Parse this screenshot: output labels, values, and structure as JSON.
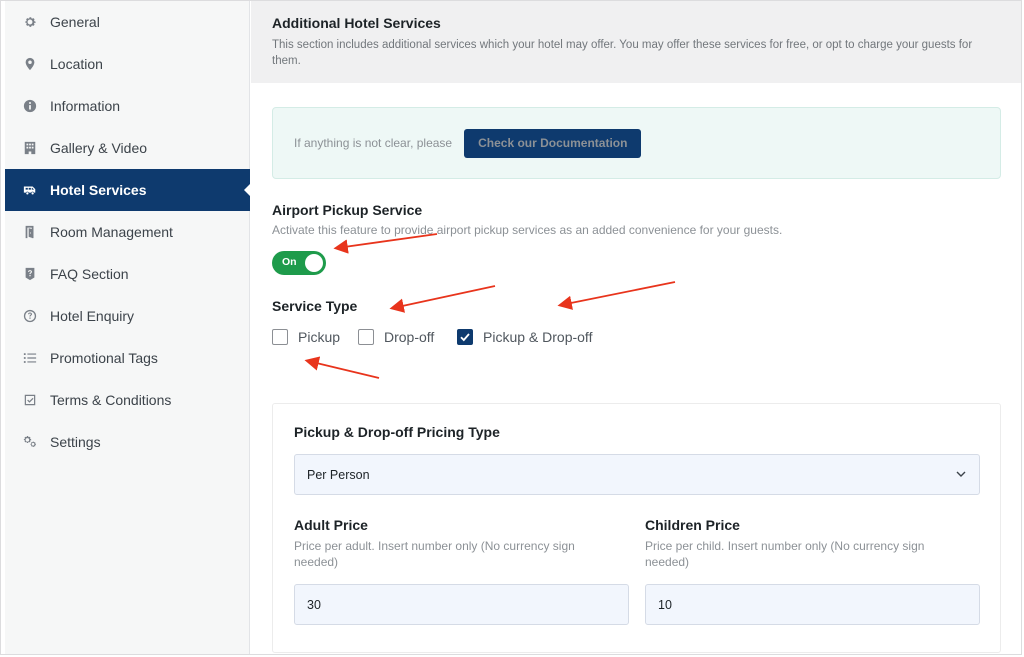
{
  "sidebar": {
    "items": [
      {
        "label": "General",
        "icon": "gear-icon"
      },
      {
        "label": "Location",
        "icon": "map-pin-icon"
      },
      {
        "label": "Information",
        "icon": "info-icon"
      },
      {
        "label": "Gallery & Video",
        "icon": "building-icon"
      },
      {
        "label": "Hotel Services",
        "icon": "van-icon",
        "active": true
      },
      {
        "label": "Room Management",
        "icon": "door-icon"
      },
      {
        "label": "FAQ Section",
        "icon": "question-badge-icon"
      },
      {
        "label": "Hotel Enquiry",
        "icon": "help-circle-icon"
      },
      {
        "label": "Promotional Tags",
        "icon": "list-icon"
      },
      {
        "label": "Terms & Conditions",
        "icon": "checkbox-icon"
      },
      {
        "label": "Settings",
        "icon": "gears-icon"
      }
    ]
  },
  "header": {
    "title": "Additional Hotel Services",
    "description": "This section includes additional services which your hotel may offer. You may offer these services for free, or opt to charge your guests for them."
  },
  "notice": {
    "text": "If anything is not clear, please",
    "button_label": "Check our Documentation"
  },
  "airport_pickup": {
    "title": "Airport Pickup Service",
    "description": "Activate this feature to provide airport pickup services as an added convenience for your guests.",
    "toggle_label": "On"
  },
  "service_type": {
    "title": "Service Type",
    "options": [
      {
        "label": "Pickup",
        "checked": false
      },
      {
        "label": "Drop-off",
        "checked": false
      },
      {
        "label": "Pickup & Drop-off",
        "checked": true
      }
    ]
  },
  "pricing": {
    "title": "Pickup & Drop-off Pricing Type",
    "selected": "Per Person",
    "adult": {
      "label": "Adult Price",
      "description": "Price per adult. Insert number only (No currency sign needed)",
      "value": "30"
    },
    "children": {
      "label": "Children Price",
      "description": "Price per child. Insert number only (No currency sign needed)",
      "value": "10"
    }
  },
  "colors": {
    "accent": "#0e3a6e",
    "toggle_on": "#1e9b4b",
    "annotation_arrow": "#e8341c"
  }
}
